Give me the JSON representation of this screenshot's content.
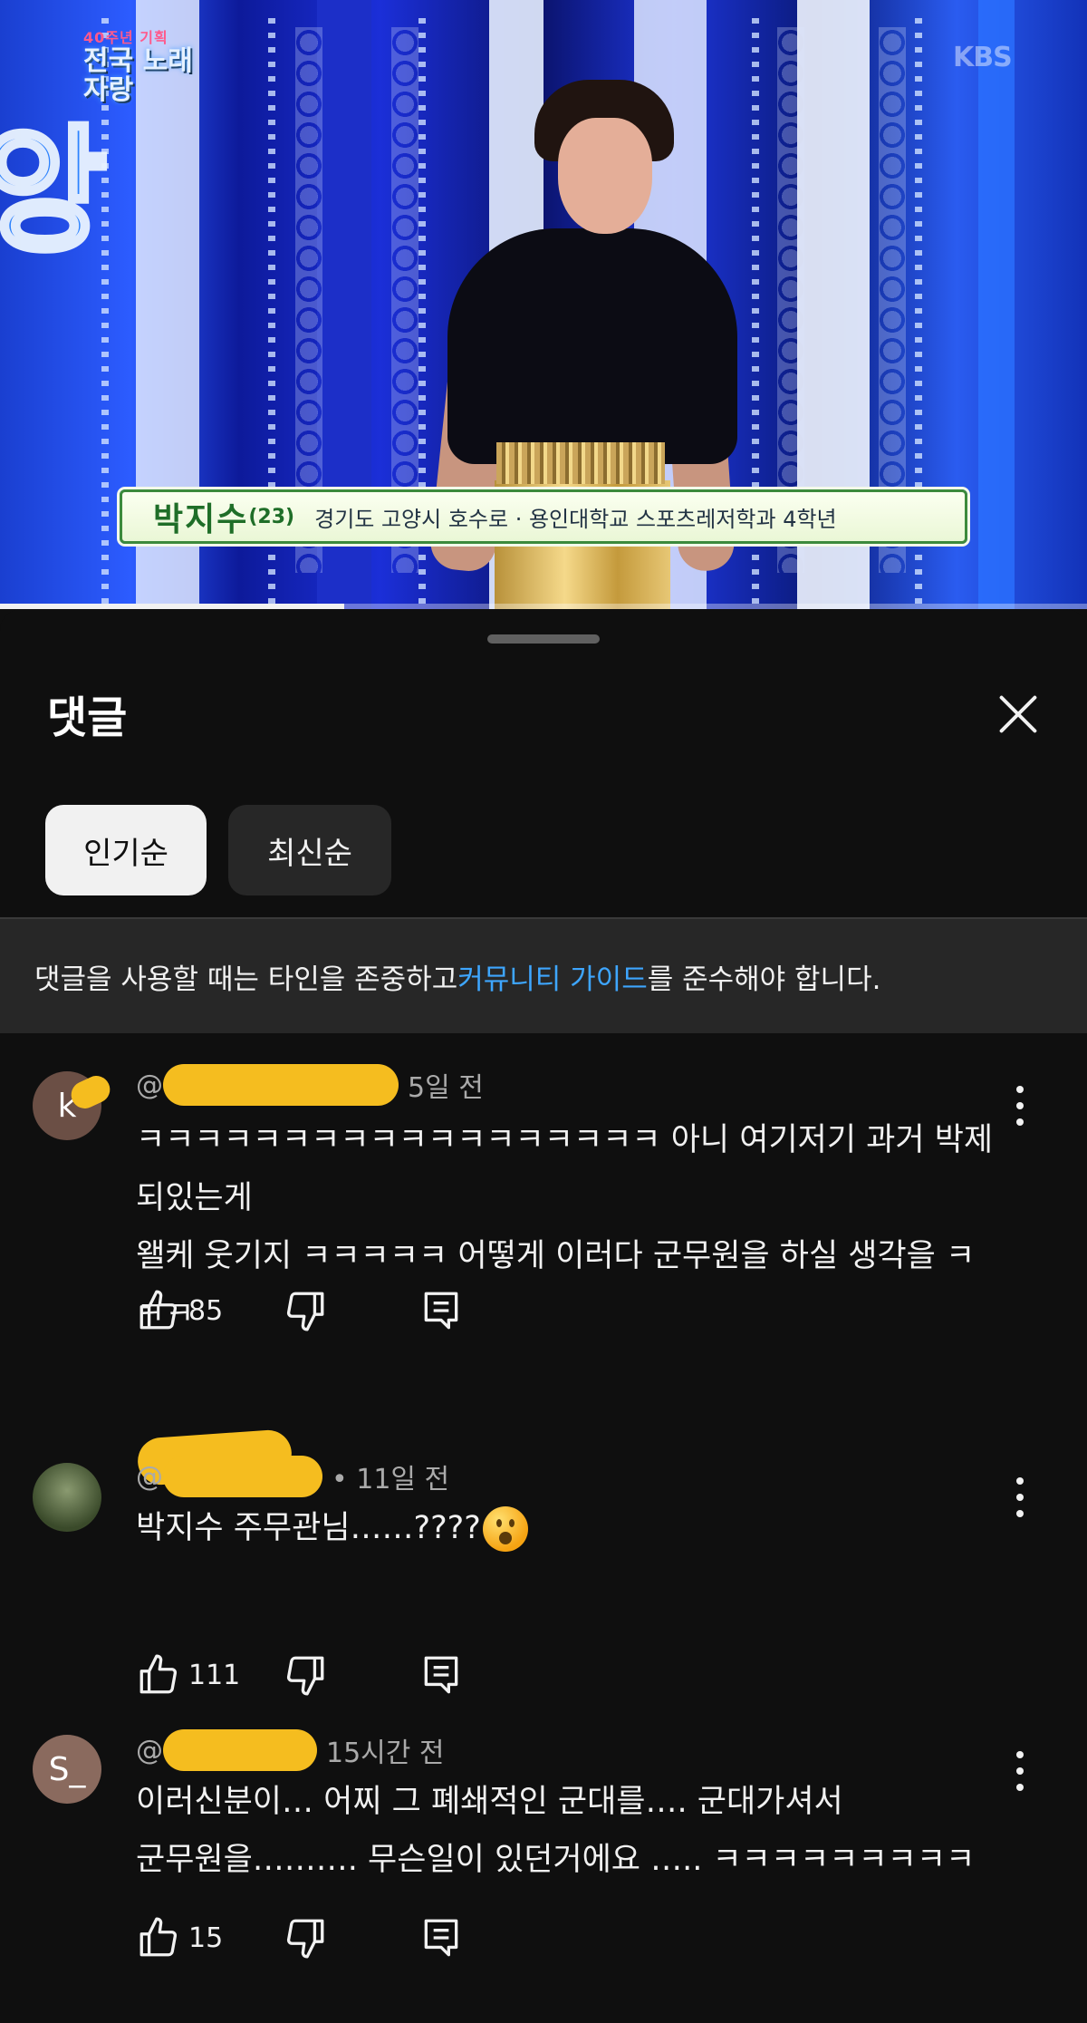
{
  "video": {
    "logo_small": "40주년 기획",
    "logo_title": "전국 노래자랑",
    "channel_watermark": "KBS",
    "caption_name": "박지수",
    "caption_age": "(23)",
    "caption_desc": "경기도 고양시 호수로 · 용인대학교 스포츠레저학과 4학년",
    "progress": 0.317
  },
  "sheet": {
    "title": "댓글",
    "sort_options": [
      "인기순",
      "최신순"
    ],
    "selected_sort": "인기순",
    "guideline_prefix": "댓글을 사용할 때는 타인을 존중하고 ",
    "guideline_link": "커뮤니티 가이드",
    "guideline_suffix": "를 준수해야 합니다."
  },
  "comments": [
    {
      "avatar_letter": "k",
      "avatar_color": "#6b4f45",
      "handle_prefix": "@",
      "time": "5일 전",
      "text": "ㅋㅋㅋㅋㅋㅋㅋㅋㅋㅋㅋㅋㅋㅋㅋㅋㅋㅋ 아니 여기저기 과거 박제되있는게\n왤케 웃기지 ㅋㅋㅋㅋㅋ 어떻게 이러다 군무원을 하실 생각을 ㅋ\nㅋㅋ",
      "likes": "85"
    },
    {
      "avatar_letter": "",
      "avatar_color": "#4a5a3a",
      "handle_prefix": "@",
      "time": "• 11일 전",
      "text": "박지수 주무관님……????",
      "likes": "111"
    },
    {
      "avatar_letter": "S_",
      "avatar_color": "#8a6a5e",
      "handle_prefix": "@",
      "time": "15시간 전",
      "text": "이러신분이… 어찌 그 폐쇄적인 군대를…. 군대가셔서\n군무원을………. 무슨일이 있던거에요 ….. ㅋㅋㅋㅋㅋㅋㅋㅋㅋ",
      "likes": "15"
    }
  ],
  "icons": {
    "like": "thumbs-up-icon",
    "dislike": "thumbs-down-icon",
    "reply": "reply-icon",
    "more": "more-vert-icon",
    "close": "close-icon"
  },
  "colors": {
    "background": "#0f0f0f",
    "chip_selected": "#f1f1f1",
    "chip_default": "#272727",
    "link": "#3ea6ff",
    "redaction": "#f5bd1f"
  }
}
